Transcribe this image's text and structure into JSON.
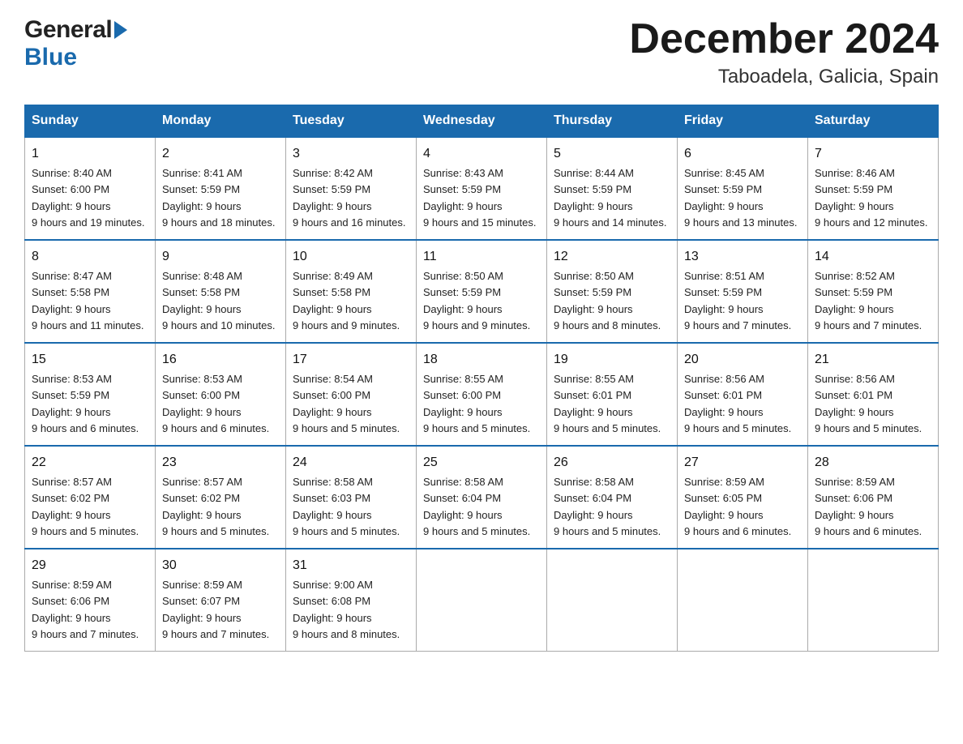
{
  "header": {
    "month": "December 2024",
    "location": "Taboadela, Galicia, Spain",
    "logo_general": "General",
    "logo_blue": "Blue"
  },
  "weekdays": [
    "Sunday",
    "Monday",
    "Tuesday",
    "Wednesday",
    "Thursday",
    "Friday",
    "Saturday"
  ],
  "weeks": [
    [
      {
        "day": "1",
        "sunrise": "8:40 AM",
        "sunset": "6:00 PM",
        "daylight": "9 hours and 19 minutes."
      },
      {
        "day": "2",
        "sunrise": "8:41 AM",
        "sunset": "5:59 PM",
        "daylight": "9 hours and 18 minutes."
      },
      {
        "day": "3",
        "sunrise": "8:42 AM",
        "sunset": "5:59 PM",
        "daylight": "9 hours and 16 minutes."
      },
      {
        "day": "4",
        "sunrise": "8:43 AM",
        "sunset": "5:59 PM",
        "daylight": "9 hours and 15 minutes."
      },
      {
        "day": "5",
        "sunrise": "8:44 AM",
        "sunset": "5:59 PM",
        "daylight": "9 hours and 14 minutes."
      },
      {
        "day": "6",
        "sunrise": "8:45 AM",
        "sunset": "5:59 PM",
        "daylight": "9 hours and 13 minutes."
      },
      {
        "day": "7",
        "sunrise": "8:46 AM",
        "sunset": "5:59 PM",
        "daylight": "9 hours and 12 minutes."
      }
    ],
    [
      {
        "day": "8",
        "sunrise": "8:47 AM",
        "sunset": "5:58 PM",
        "daylight": "9 hours and 11 minutes."
      },
      {
        "day": "9",
        "sunrise": "8:48 AM",
        "sunset": "5:58 PM",
        "daylight": "9 hours and 10 minutes."
      },
      {
        "day": "10",
        "sunrise": "8:49 AM",
        "sunset": "5:58 PM",
        "daylight": "9 hours and 9 minutes."
      },
      {
        "day": "11",
        "sunrise": "8:50 AM",
        "sunset": "5:59 PM",
        "daylight": "9 hours and 9 minutes."
      },
      {
        "day": "12",
        "sunrise": "8:50 AM",
        "sunset": "5:59 PM",
        "daylight": "9 hours and 8 minutes."
      },
      {
        "day": "13",
        "sunrise": "8:51 AM",
        "sunset": "5:59 PM",
        "daylight": "9 hours and 7 minutes."
      },
      {
        "day": "14",
        "sunrise": "8:52 AM",
        "sunset": "5:59 PM",
        "daylight": "9 hours and 7 minutes."
      }
    ],
    [
      {
        "day": "15",
        "sunrise": "8:53 AM",
        "sunset": "5:59 PM",
        "daylight": "9 hours and 6 minutes."
      },
      {
        "day": "16",
        "sunrise": "8:53 AM",
        "sunset": "6:00 PM",
        "daylight": "9 hours and 6 minutes."
      },
      {
        "day": "17",
        "sunrise": "8:54 AM",
        "sunset": "6:00 PM",
        "daylight": "9 hours and 5 minutes."
      },
      {
        "day": "18",
        "sunrise": "8:55 AM",
        "sunset": "6:00 PM",
        "daylight": "9 hours and 5 minutes."
      },
      {
        "day": "19",
        "sunrise": "8:55 AM",
        "sunset": "6:01 PM",
        "daylight": "9 hours and 5 minutes."
      },
      {
        "day": "20",
        "sunrise": "8:56 AM",
        "sunset": "6:01 PM",
        "daylight": "9 hours and 5 minutes."
      },
      {
        "day": "21",
        "sunrise": "8:56 AM",
        "sunset": "6:01 PM",
        "daylight": "9 hours and 5 minutes."
      }
    ],
    [
      {
        "day": "22",
        "sunrise": "8:57 AM",
        "sunset": "6:02 PM",
        "daylight": "9 hours and 5 minutes."
      },
      {
        "day": "23",
        "sunrise": "8:57 AM",
        "sunset": "6:02 PM",
        "daylight": "9 hours and 5 minutes."
      },
      {
        "day": "24",
        "sunrise": "8:58 AM",
        "sunset": "6:03 PM",
        "daylight": "9 hours and 5 minutes."
      },
      {
        "day": "25",
        "sunrise": "8:58 AM",
        "sunset": "6:04 PM",
        "daylight": "9 hours and 5 minutes."
      },
      {
        "day": "26",
        "sunrise": "8:58 AM",
        "sunset": "6:04 PM",
        "daylight": "9 hours and 5 minutes."
      },
      {
        "day": "27",
        "sunrise": "8:59 AM",
        "sunset": "6:05 PM",
        "daylight": "9 hours and 6 minutes."
      },
      {
        "day": "28",
        "sunrise": "8:59 AM",
        "sunset": "6:06 PM",
        "daylight": "9 hours and 6 minutes."
      }
    ],
    [
      {
        "day": "29",
        "sunrise": "8:59 AM",
        "sunset": "6:06 PM",
        "daylight": "9 hours and 7 minutes."
      },
      {
        "day": "30",
        "sunrise": "8:59 AM",
        "sunset": "6:07 PM",
        "daylight": "9 hours and 7 minutes."
      },
      {
        "day": "31",
        "sunrise": "9:00 AM",
        "sunset": "6:08 PM",
        "daylight": "9 hours and 8 minutes."
      },
      null,
      null,
      null,
      null
    ]
  ]
}
